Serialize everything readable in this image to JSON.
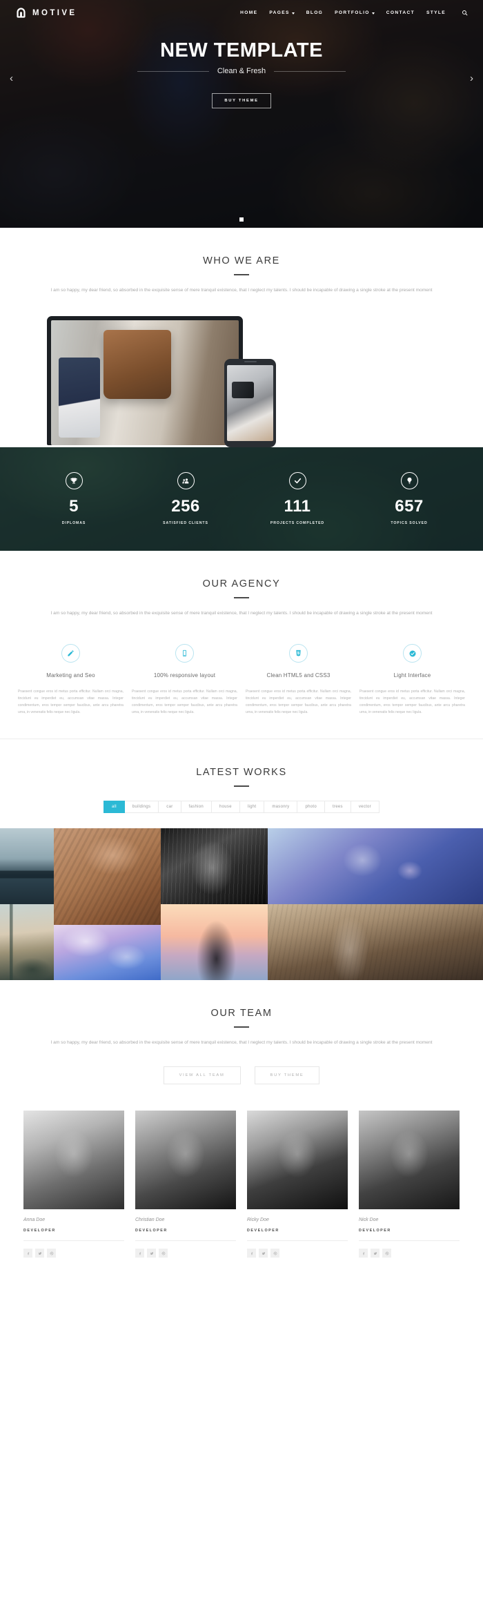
{
  "brand": {
    "name": "MOTIVE",
    "logo_icon": "motive-arch-logo"
  },
  "nav": {
    "items": [
      {
        "label": "HOME",
        "has_dropdown": false
      },
      {
        "label": "PAGES",
        "has_dropdown": true
      },
      {
        "label": "BLOG",
        "has_dropdown": false
      },
      {
        "label": "PORTFOLIO",
        "has_dropdown": true
      },
      {
        "label": "CONTACT",
        "has_dropdown": false
      },
      {
        "label": "STYLE",
        "has_dropdown": false
      }
    ],
    "search_icon": "search-icon"
  },
  "hero": {
    "title": "NEW TEMPLATE",
    "subtitle": "Clean & Fresh",
    "cta_label": "BUY THEME",
    "prev_arrow": "‹",
    "next_arrow": "›",
    "slide_count": 1,
    "active_slide": 1
  },
  "who_we_are": {
    "title": "WHO WE ARE",
    "lead": "I am so happy, my dear friend, so absorbed in the exquisite sense of mere tranquil existence, that I neglect my talents. I should be incapable of drawing a single stroke at the present moment"
  },
  "stats": {
    "items": [
      {
        "icon": "trophy-icon",
        "value": "5",
        "label": "DIPLOMAS"
      },
      {
        "icon": "users-icon",
        "value": "256",
        "label": "SATISFIED CLIENTS"
      },
      {
        "icon": "check-circle-icon",
        "value": "111",
        "label": "PROJECTS COMPLETED"
      },
      {
        "icon": "lightbulb-icon",
        "value": "657",
        "label": "TOPICS SOLVED"
      }
    ]
  },
  "our_agency": {
    "title": "OUR AGENCY",
    "lead": "I am so happy, my dear friend, so absorbed in the exquisite sense of mere tranquil existence, that I neglect my talents. I should be incapable of drawing a single stroke at the present moment",
    "features": [
      {
        "icon": "pencil-icon",
        "title": "Marketing and Seo",
        "body": "Praesent congue eros id metus porta efficitur. Nullam orci magna, tincidunt eu imperdiet eu, accumsan vitae massa. Integer condimentum, eros tempor semper faucibus, ante arcu pharetra urna, in venenatis felis neque nec ligula."
      },
      {
        "icon": "mobile-icon",
        "title": "100% responsive layout",
        "body": "Praesent congue eros id metus porta efficitur. Nullam orci magna, tincidunt eu imperdiet eu, accumsan vitae massa. Integer condimentum, eros tempor semper faucibus, ante arcu pharetra urna, in venenatis felis neque nec ligula."
      },
      {
        "icon": "html5-icon",
        "title": "Clean HTML5 and CSS3",
        "body": "Praesent congue eros id metus porta efficitur. Nullam orci magna, tincidunt eu imperdiet eu, accumsan vitae massa. Integer condimentum, eros tempor semper faucibus, ante arcu pharetra urna, in venenatis felis neque nec ligula."
      },
      {
        "icon": "shield-check-icon",
        "title": "Light Interface",
        "body": "Praesent congue eros id metus porta efficitur. Nullam orci magna, tincidunt eu imperdiet eu, accumsan vitae massa. Integer condimentum, eros tempor semper faucibus, ante arcu pharetra urna, in venenatis felis neque nec ligula."
      }
    ]
  },
  "latest_works": {
    "title": "LATEST WORKS",
    "filters": [
      {
        "label": "all",
        "active": true
      },
      {
        "label": "buildings",
        "active": false
      },
      {
        "label": "car",
        "active": false
      },
      {
        "label": "fashion",
        "active": false
      },
      {
        "label": "house",
        "active": false
      },
      {
        "label": "light",
        "active": false
      },
      {
        "label": "masonry",
        "active": false
      },
      {
        "label": "photo",
        "active": false
      },
      {
        "label": "trees",
        "active": false
      },
      {
        "label": "vector",
        "active": false
      }
    ],
    "active_filter_color": "#2bb9d5",
    "tiles": [
      {
        "name": "bridge-lake-photo"
      },
      {
        "name": "paris-rooftops-photo"
      },
      {
        "name": "stone-statue-photo"
      },
      {
        "name": "clouds-sky-photo"
      },
      {
        "name": "dark-portrait-photo"
      },
      {
        "name": "sunset-fashion-photo"
      },
      {
        "name": "blue-portrait-photo"
      },
      {
        "name": "blonde-model-photo"
      }
    ]
  },
  "our_team": {
    "title": "OUR TEAM",
    "lead": "I am so happy, my dear friend, so absorbed in the exquisite sense of mere tranquil existence, that I neglect my talents. I should be incapable of drawing a single stroke at the present moment",
    "view_all_label": "VIEW ALL TEAM",
    "buy_theme_label": "BUY THEME",
    "members": [
      {
        "name": "Anna Doe",
        "role": "DEVELOPER",
        "socials": [
          "facebook-icon",
          "twitter-icon",
          "dribbble-icon"
        ]
      },
      {
        "name": "Christian Doe",
        "role": "DEVELOPER",
        "socials": [
          "facebook-icon",
          "twitter-icon",
          "dribbble-icon"
        ]
      },
      {
        "name": "Ricky Doe",
        "role": "DEVELOPER",
        "socials": [
          "facebook-icon",
          "twitter-icon",
          "dribbble-icon"
        ]
      },
      {
        "name": "Nick Doe",
        "role": "DEVELOPER",
        "socials": [
          "facebook-icon",
          "twitter-icon",
          "dribbble-icon"
        ]
      }
    ]
  }
}
